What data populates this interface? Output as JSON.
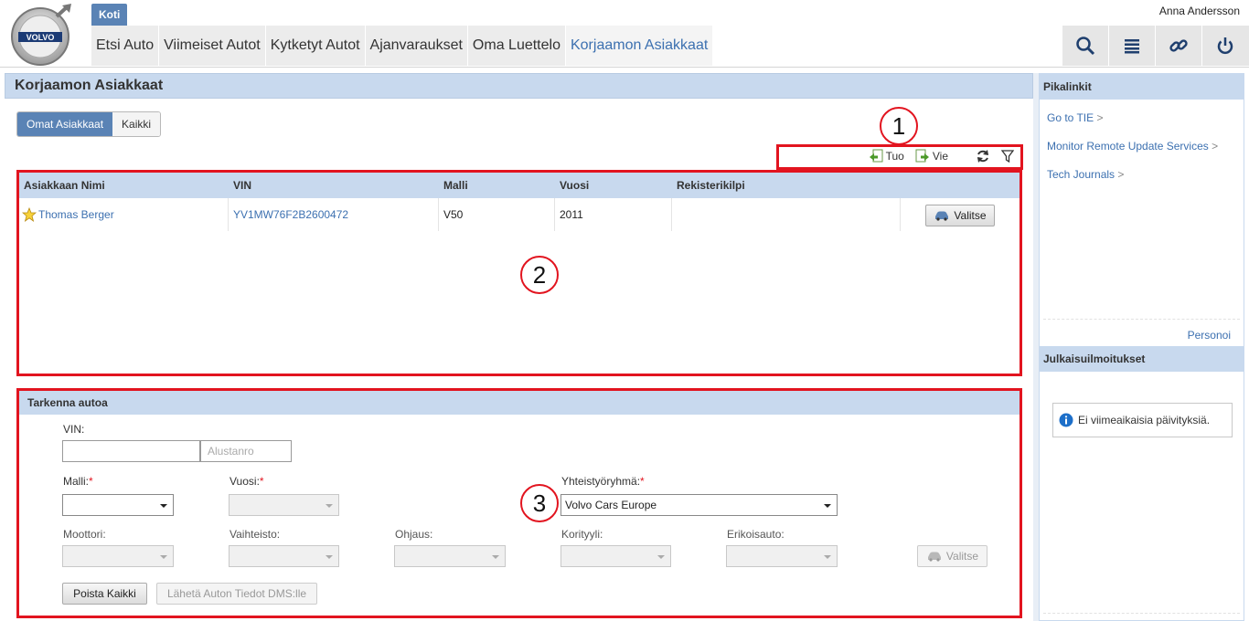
{
  "header": {
    "home_tab": "Koti",
    "user": "Anna Andersson",
    "nav": [
      "Etsi Auto",
      "Viimeiset Autot",
      "Kytketyt Autot",
      "Ajanvaraukset",
      "Oma Luettelo",
      "Korjaamon Asiakkaat"
    ],
    "icons": [
      "search-icon",
      "list-icon",
      "link-icon",
      "power-icon"
    ],
    "logo_text": "VOLVO"
  },
  "page": {
    "title": "Korjaamon Asiakkaat",
    "toggle": {
      "own": "Omat Asiakkaat",
      "all": "Kaikki"
    },
    "actions": {
      "import": "Tuo",
      "export": "Vie"
    }
  },
  "table": {
    "columns": [
      "Asiakkaan Nimi",
      "VIN",
      "Malli",
      "Vuosi",
      "Rekisterikilpi"
    ],
    "rows": [
      {
        "name": "Thomas Berger",
        "vin": "YV1MW76F2B2600472",
        "model": "V50",
        "year": "2011",
        "plate": "",
        "button": "Valitse"
      }
    ]
  },
  "refine": {
    "title": "Tarkenna autoa",
    "vin_label": "VIN:",
    "vin_value": "",
    "alt_placeholder": "Alustanro",
    "model_label": "Malli:",
    "year_label": "Vuosi:",
    "group_label": "Yhteistyöryhmä:",
    "group_value": "Volvo Cars Europe",
    "required_mark": "*",
    "engine_label": "Moottori:",
    "gearbox_label": "Vaihteisto:",
    "steering_label": "Ohjaus:",
    "body_label": "Korityyli:",
    "special_label": "Erikoisauto:",
    "select_button": "Valitse",
    "clear_button": "Poista Kaikki",
    "send_button": "Lähetä Auton Tiedot DMS:lle"
  },
  "sidebar": {
    "quicklinks_title": "Pikalinkit",
    "links": [
      "Go to TIE",
      "Monitor Remote Update Services",
      "Tech Journals"
    ],
    "link_suffix": ">",
    "personalize": "Personoi",
    "releases_title": "Julkaisuilmoitukset",
    "no_updates": "Ei viimeaikaisia päivityksiä."
  },
  "callouts": [
    "1",
    "2",
    "3"
  ],
  "colors": {
    "accent": "#5a83b5",
    "header_bg": "#c8d9ee",
    "highlight": "#e2141f",
    "link": "#3c70b0"
  }
}
